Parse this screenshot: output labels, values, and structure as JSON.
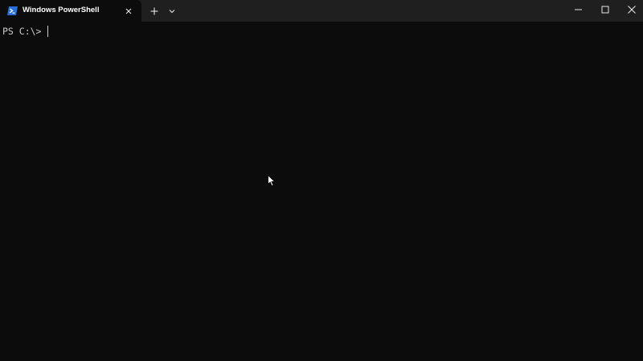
{
  "window": {
    "tab_title": "Windows PowerShell"
  },
  "terminal": {
    "prompt": "PS C:\\> "
  },
  "icons": {
    "tab_icon": "powershell-icon",
    "tab_close": "close-icon",
    "new_tab": "plus-icon",
    "dropdown": "chevron-down-icon",
    "minimize": "minimize-icon",
    "maximize": "maximize-icon",
    "close": "close-icon",
    "pointer": "mouse-pointer-icon"
  },
  "colors": {
    "background": "#0c0c0c",
    "titlebar": "#1f1f1f",
    "text": "#cccccc",
    "accent": "#2b6fd6"
  }
}
